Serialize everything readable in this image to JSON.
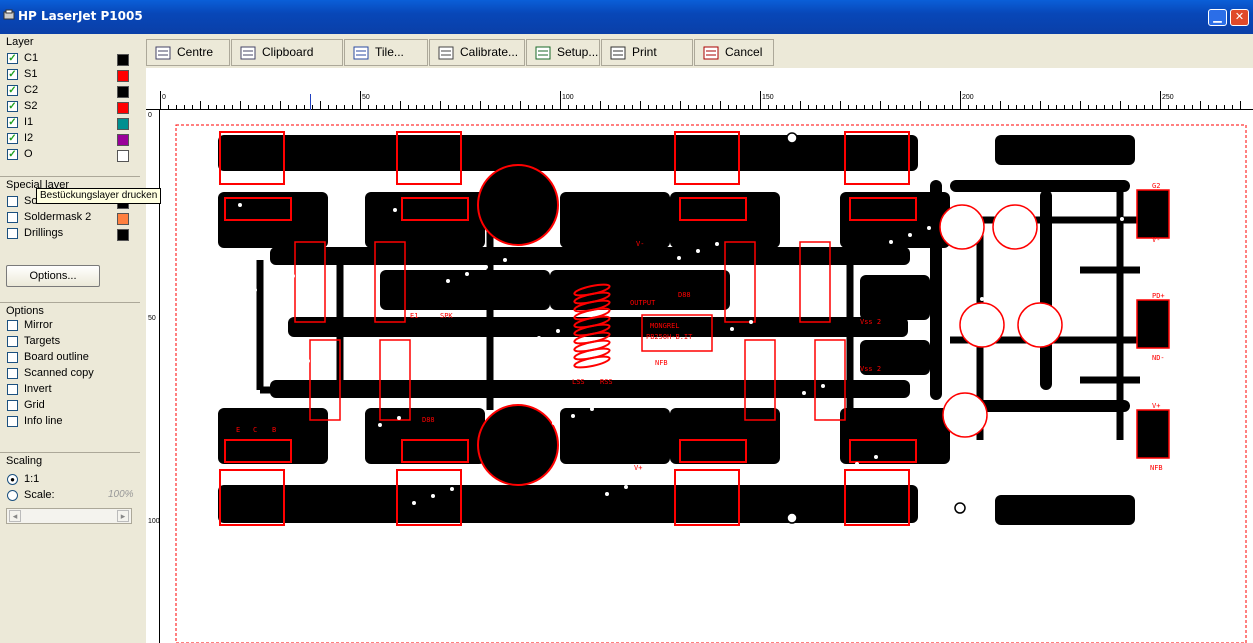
{
  "window": {
    "title": "HP LaserJet P1005",
    "minimize_glyph": "▁",
    "close_glyph": "✕"
  },
  "layer_group": {
    "title": "Layer",
    "items": [
      {
        "label": "C1",
        "checked": true,
        "color": "#000000"
      },
      {
        "label": "S1",
        "checked": true,
        "color": "#ff0000"
      },
      {
        "label": "C2",
        "checked": true,
        "color": "#000000"
      },
      {
        "label": "S2",
        "checked": true,
        "color": "#ff0000"
      },
      {
        "label": "I1",
        "checked": true,
        "color": "#009090"
      },
      {
        "label": "I2",
        "checked": true,
        "color": "#990099"
      },
      {
        "label": "O",
        "checked": true,
        "color": "#ffffff"
      }
    ]
  },
  "tooltip": "Bestückungslayer drucken",
  "special_group": {
    "title": "Special layer",
    "items": [
      {
        "label": "Soldermask 1",
        "checked": false,
        "color": "#000000"
      },
      {
        "label": "Soldermask 2",
        "checked": false,
        "color": "#ff8040"
      },
      {
        "label": "Drillings",
        "checked": false,
        "color": "#000000"
      }
    ],
    "options_button": "Options..."
  },
  "options_group": {
    "title": "Options",
    "items": [
      {
        "label": "Mirror",
        "checked": false
      },
      {
        "label": "Targets",
        "checked": false
      },
      {
        "label": "Board outline",
        "checked": false
      },
      {
        "label": "Scanned copy",
        "checked": false
      },
      {
        "label": "Invert",
        "checked": false
      },
      {
        "label": "Grid",
        "checked": false
      },
      {
        "label": "Info line",
        "checked": false
      }
    ]
  },
  "scaling_group": {
    "title": "Scaling",
    "options": [
      {
        "label": "1:1",
        "selected": true
      },
      {
        "label": "Scale:",
        "selected": false
      }
    ],
    "scale_value": "100%"
  },
  "toolbar": {
    "buttons": [
      {
        "label": "Centre",
        "icon": "centre-icon"
      },
      {
        "label": "Clipboard",
        "icon": "clipboard-icon"
      },
      {
        "label": "Tile...",
        "icon": "tile-icon"
      },
      {
        "label": "Calibrate...",
        "icon": "calibrate-icon"
      },
      {
        "label": "Setup...",
        "icon": "setup-icon"
      },
      {
        "label": "Print",
        "icon": "printer-icon"
      },
      {
        "label": "Cancel",
        "icon": "cancel-icon"
      }
    ]
  },
  "ruler": {
    "top_labels": [
      "0",
      "50",
      "100",
      "150",
      "200",
      "250"
    ],
    "left_labels": [
      "0",
      "50",
      "100"
    ]
  },
  "board": {
    "colors": {
      "copper": "#000000",
      "silk": "#ff0000",
      "outline": "#ff0000"
    },
    "silk_texts": [
      "MONGREL",
      "PB250H-B.IT",
      "OUTPUT",
      "NFB",
      "G2",
      "PD+",
      "V+",
      "V-",
      "ND-",
      "NFB",
      "D88",
      "E1",
      "SPK",
      "LSS",
      "RSS",
      "Vss 2",
      "Vss 2",
      "V-",
      "V+",
      "D88",
      "E",
      "C",
      "B"
    ]
  }
}
